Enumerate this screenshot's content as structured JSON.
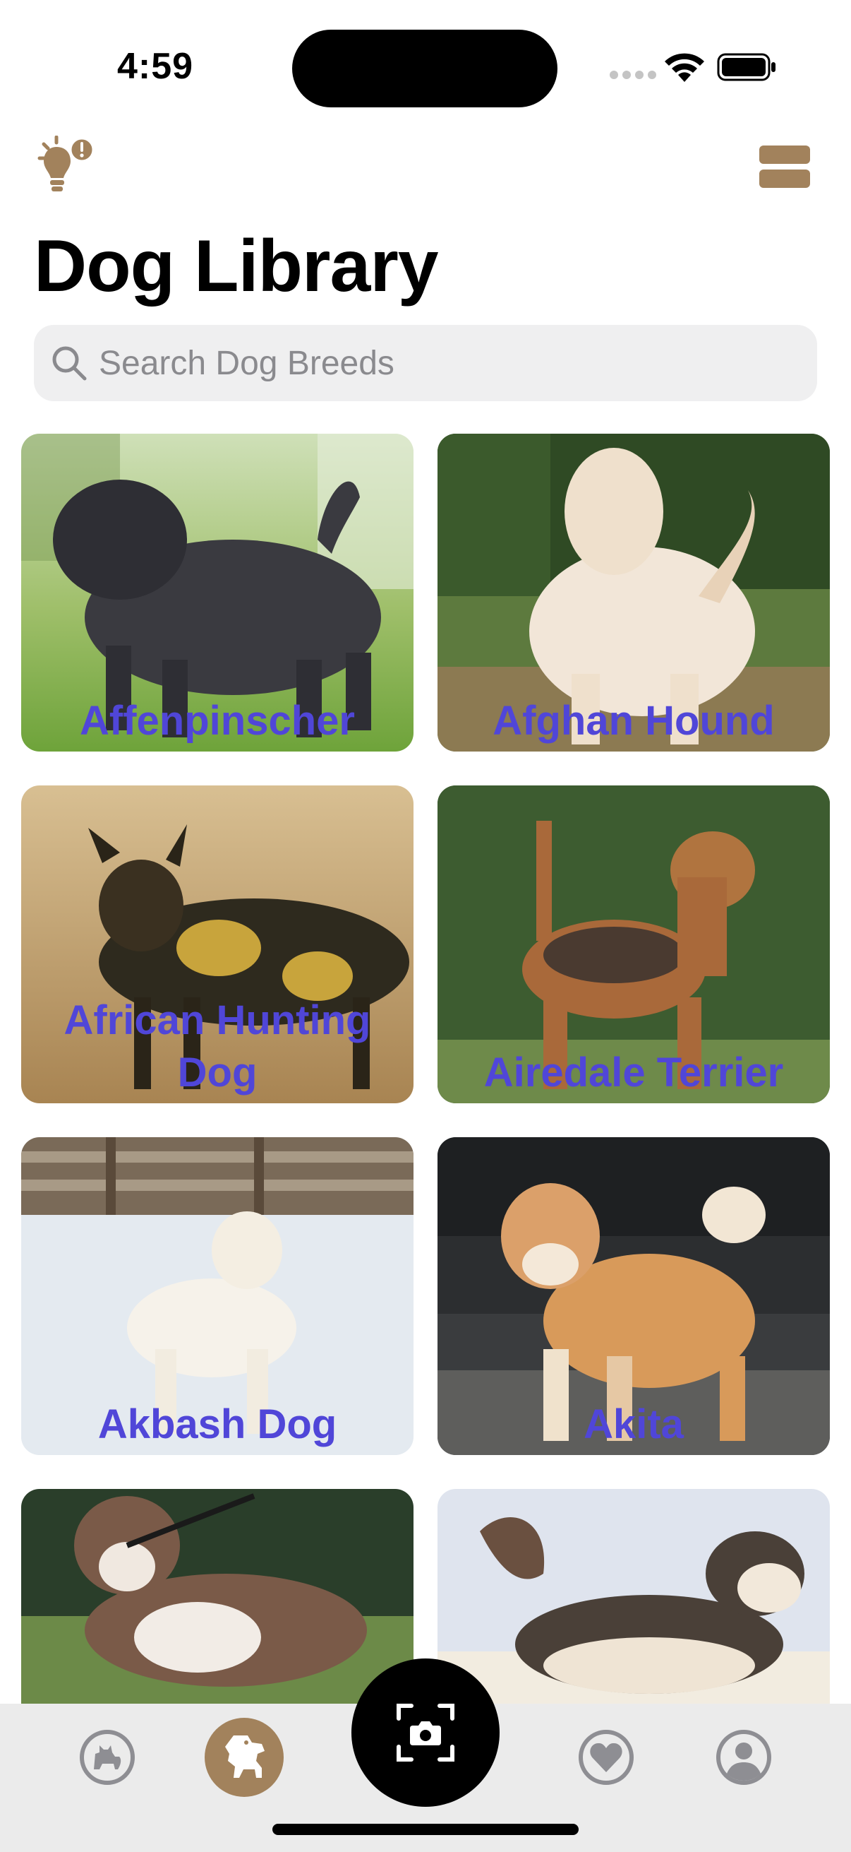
{
  "status_bar": {
    "time": "4:59"
  },
  "header": {
    "title": "Dog Library"
  },
  "search": {
    "placeholder": "Search Dog Breeds"
  },
  "breeds": [
    {
      "name": "Affenpinscher",
      "image": "dark-shaggy-dog-on-grass"
    },
    {
      "name": "Afghan Hound",
      "image": "long-haired-cream-hound-in-field"
    },
    {
      "name": "African Hunting Dog",
      "image": "spotted-wild-dog-in-dry-grass"
    },
    {
      "name": "Airedale Terrier",
      "image": "tan-terrier-in-front-of-hedge"
    },
    {
      "name": "Akbash Dog",
      "image": "white-dog-in-snow"
    },
    {
      "name": "Akita",
      "image": "orange-white-akita-on-path"
    },
    {
      "name": "",
      "image": "brown-white-bulldog-on-grass"
    },
    {
      "name": "",
      "image": "husky-running-in-snow"
    }
  ],
  "tab_bar": {
    "tabs": [
      "cat-icon",
      "dog-icon",
      "camera-scan-icon",
      "heart-icon",
      "profile-icon"
    ],
    "active": "dog-icon"
  },
  "colors": {
    "accent": "#a2825c",
    "breed_label": "#5046d8",
    "tab_bar_bg": "#ebebeb",
    "search_bg": "#efeff0"
  }
}
